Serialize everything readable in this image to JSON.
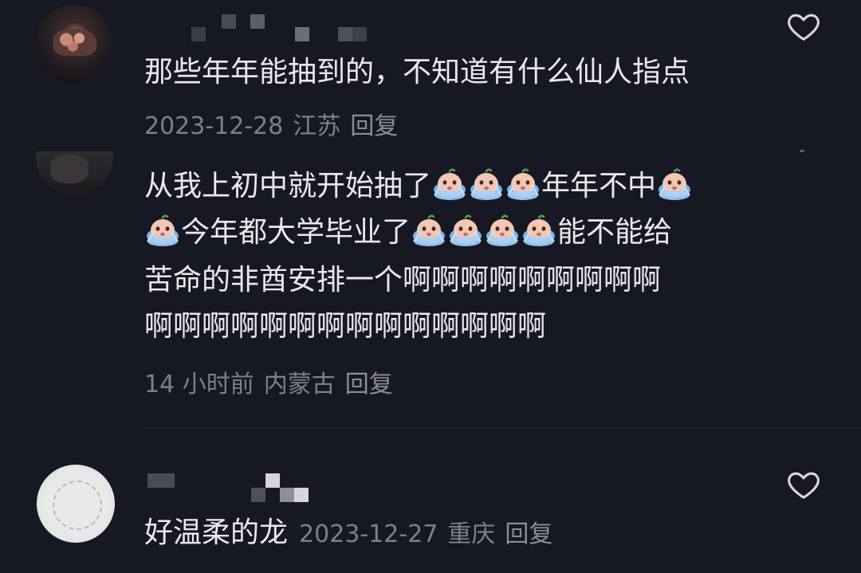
{
  "comments": [
    {
      "text": "那些年年能抽到的，不知道有什么仙人指点",
      "date": "2023-12-28",
      "location": "江苏",
      "reply_label": "回复"
    },
    {
      "lines": [
        "从我上初中就开始抽了",
        "年年不中",
        "今年都大学毕业了",
        "能不能给",
        "苦命的非酋安排一个啊啊啊啊啊啊啊啊啊",
        "啊啊啊啊啊啊啊啊啊啊啊啊啊啊"
      ],
      "time": "14 小时前",
      "location": "内蒙古",
      "reply_label": "回复"
    },
    {
      "text": "好温柔的龙",
      "date": "2023-12-27",
      "location": "重庆",
      "reply_label": "回复"
    }
  ],
  "icons": {
    "like": "heart-outline-icon",
    "emoji": "crying-emoji-icon"
  },
  "colors": {
    "background": "#161823",
    "text": "#e9e9ee",
    "meta": "#7e8088"
  }
}
